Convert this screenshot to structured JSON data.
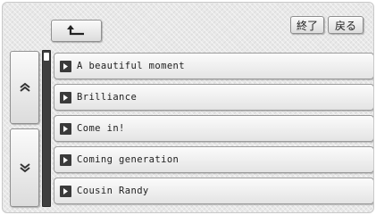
{
  "header": {
    "end_label": "終了",
    "back_label": "戻る",
    "parent_icon": "return-arrow-icon"
  },
  "scroll": {
    "up_icon": "double-chevron-up-icon",
    "down_icon": "double-chevron-down-icon",
    "visible_fraction": 0.05,
    "position_fraction": 0.0
  },
  "list": {
    "item_icon": "play-folder-icon",
    "items": [
      {
        "label": "A beautiful moment"
      },
      {
        "label": "Brilliance"
      },
      {
        "label": "Come in!"
      },
      {
        "label": "Coming generation"
      },
      {
        "label": "Cousin Randy"
      }
    ]
  }
}
